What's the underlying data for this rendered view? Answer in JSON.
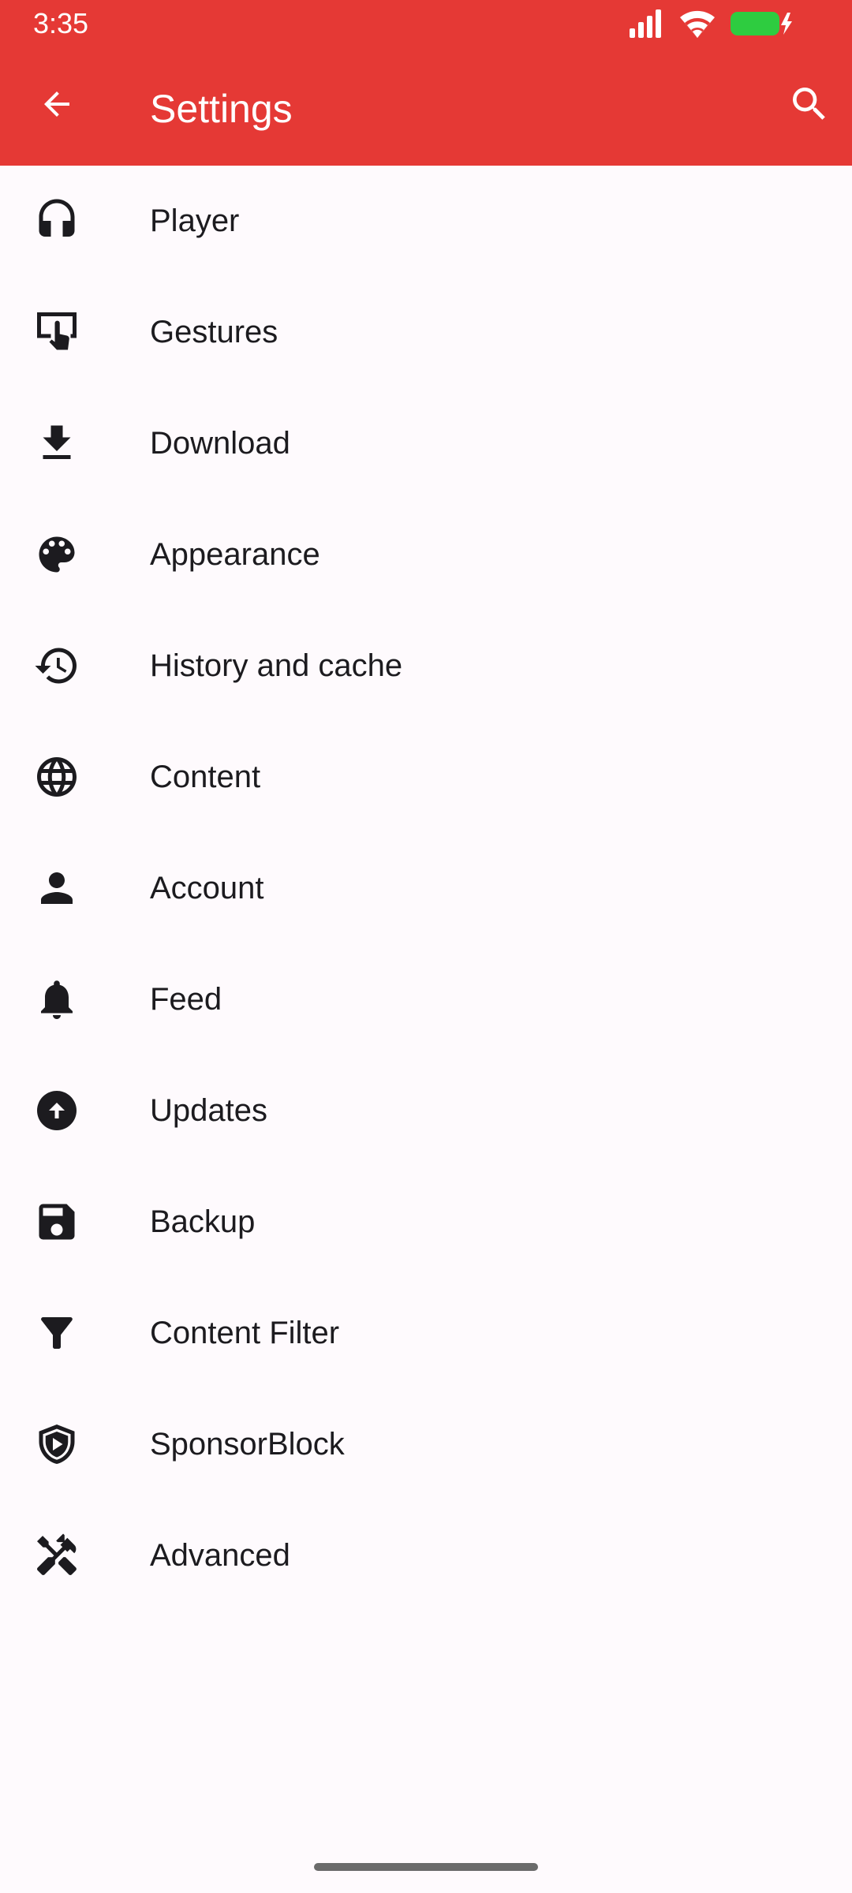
{
  "status_bar": {
    "time": "3:35"
  },
  "app_bar": {
    "title": "Settings",
    "color": "#e53935"
  },
  "items": [
    {
      "label": "Player",
      "icon": "headphones-icon"
    },
    {
      "label": "Gestures",
      "icon": "gesture-tap-icon"
    },
    {
      "label": "Download",
      "icon": "download-icon"
    },
    {
      "label": "Appearance",
      "icon": "palette-icon"
    },
    {
      "label": "History and cache",
      "icon": "history-icon"
    },
    {
      "label": "Content",
      "icon": "globe-icon"
    },
    {
      "label": "Account",
      "icon": "person-icon"
    },
    {
      "label": "Feed",
      "icon": "bell-icon"
    },
    {
      "label": "Updates",
      "icon": "upload-circle-icon"
    },
    {
      "label": "Backup",
      "icon": "save-icon"
    },
    {
      "label": "Content Filter",
      "icon": "filter-icon"
    },
    {
      "label": "SponsorBlock",
      "icon": "shield-play-icon"
    },
    {
      "label": "Advanced",
      "icon": "tools-icon"
    }
  ]
}
